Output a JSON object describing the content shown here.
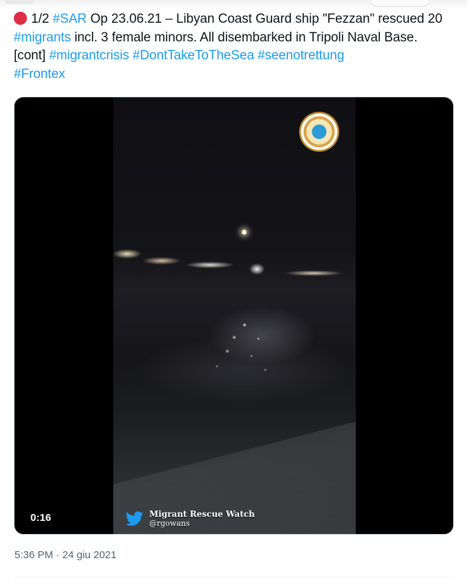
{
  "tweet": {
    "status_icon": "red-circle-icon",
    "text_parts": [
      {
        "text": "1/2 ",
        "type": "text"
      },
      {
        "text": "#SAR",
        "type": "hashtag"
      },
      {
        "text": " Op 23.06.21 – Libyan Coast Guard ship \"Fezzan\" rescued 20 ",
        "type": "text"
      },
      {
        "text": "#migrants",
        "type": "hashtag"
      },
      {
        "text": " incl. 3 female minors. All disembarked in Tripoli Naval Base. [cont] ",
        "type": "text"
      },
      {
        "text": "#migrantcrisis",
        "type": "hashtag"
      },
      {
        "text": " ",
        "type": "text"
      },
      {
        "text": "#DontTakeToTheSea",
        "type": "hashtag"
      },
      {
        "text": " ",
        "type": "text"
      },
      {
        "text": "#seenotrettung",
        "type": "hashtag"
      },
      {
        "text": " ",
        "type": "text"
      },
      {
        "text": "#Frontex",
        "type": "hashtag"
      }
    ],
    "timestamp": "5:36 PM · 24 giu 2021"
  },
  "video": {
    "duration": "0:16",
    "watermark_name": "Migrant Rescue Watch",
    "watermark_handle": "@rgowans",
    "watermark_icon": "twitter-bird-icon",
    "logo_icon": "coast-guard-emblem-icon"
  },
  "colors": {
    "hashtag": "#1d9bf0",
    "text": "#0f1419",
    "muted": "#536471",
    "status_dot": "#dd2e44"
  }
}
